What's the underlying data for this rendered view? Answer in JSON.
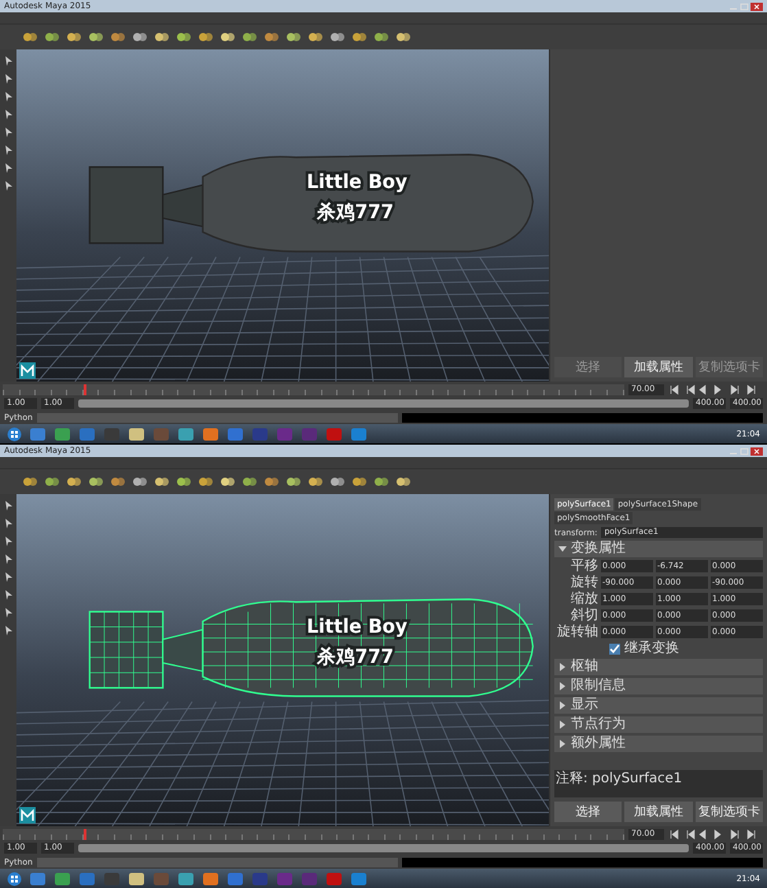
{
  "panels": [
    {
      "title": "Autodesk Maya 2015",
      "viewport": {
        "model": {
          "label": "Little Boy",
          "number": "杀鸡777",
          "selected": false
        }
      },
      "attribute_editor": {
        "buttons": [
          {
            "label": "选择",
            "disabled": true
          },
          {
            "label": "加载属性",
            "disabled": false
          },
          {
            "label": "复制选项卡",
            "disabled": true
          }
        ]
      },
      "timeline": {
        "level": 0.13,
        "current": "70.00"
      },
      "range": {
        "start": "1.00",
        "inner_start": "1.00",
        "level": 1,
        "inner_end": "400.00",
        "end": "400.00"
      },
      "command": {
        "label": "Python"
      },
      "taskbar": {
        "time": "21:04"
      }
    },
    {
      "title": "Autodesk Maya 2015",
      "viewport": {
        "model": {
          "label": "Little Boy",
          "number": "杀鸡777",
          "selected": true
        }
      },
      "attribute_editor": {
        "tabs": [
          {
            "label": "polySurface1",
            "selected": true
          },
          {
            "label": "polySurface1Shape",
            "selected": false
          },
          {
            "label": "polySmoothFace1",
            "selected": false
          }
        ],
        "transform": {
          "label": "transform:",
          "value": "polySurface1"
        },
        "sections": [
          {
            "title": "变换属性",
            "expanded": true,
            "rows": [
              {
                "label": "平移",
                "values": [
                  "0.000",
                  "-6.742",
                  "0.000"
                ]
              },
              {
                "label": "旋转",
                "values": [
                  "-90.000",
                  "0.000",
                  "-90.000"
                ]
              },
              {
                "label": "缩放",
                "values": [
                  "1.000",
                  "1.000",
                  "1.000"
                ]
              },
              {
                "label": "斜切",
                "values": [
                  "0.000",
                  "0.000",
                  "0.000"
                ]
              },
              {
                "label": "旋转轴",
                "values": [
                  "0.000",
                  "0.000",
                  "0.000"
                ]
              }
            ],
            "checkbox": {
              "label": "继承变换",
              "checked": true
            }
          },
          {
            "title": "枢轴",
            "expanded": false
          },
          {
            "title": "限制信息",
            "expanded": false
          },
          {
            "title": "显示",
            "expanded": false
          },
          {
            "title": "节点行为",
            "expanded": false
          },
          {
            "title": "额外属性",
            "expanded": false
          }
        ],
        "notes": {
          "label": "注释:",
          "value": "polySurface1"
        },
        "buttons": [
          {
            "label": "选择",
            "disabled": false
          },
          {
            "label": "加载属性",
            "disabled": false
          },
          {
            "label": "复制选项卡",
            "disabled": false
          }
        ]
      },
      "timeline": {
        "level": 0.13,
        "current": "70.00"
      },
      "range": {
        "start": "1.00",
        "inner_start": "1.00",
        "level": 1,
        "inner_end": "400.00",
        "end": "400.00"
      },
      "command": {
        "label": "Python"
      },
      "taskbar": {
        "time": "21:04"
      }
    }
  ]
}
